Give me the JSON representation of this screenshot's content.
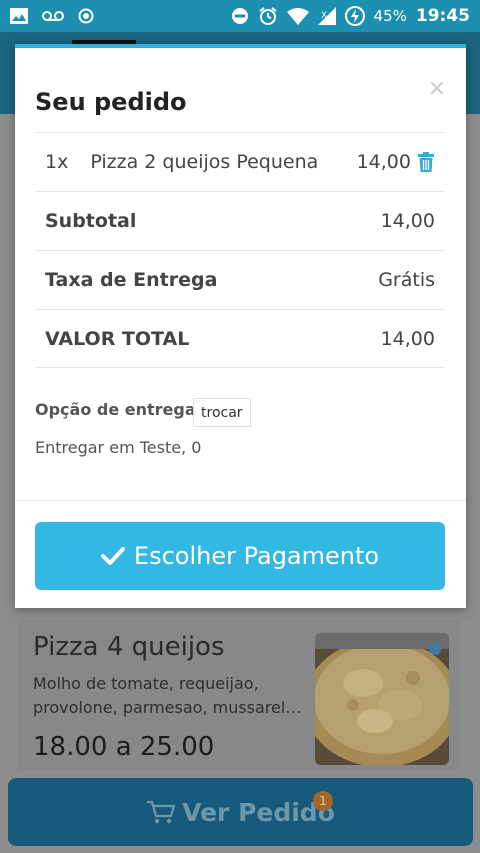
{
  "status_bar": {
    "battery_percent": "45%",
    "time": "19:45",
    "left_icons": [
      "image-icon",
      "voicemail-icon",
      "circle-dot-icon"
    ],
    "right_icons": [
      "dnd-icon",
      "alarm-icon",
      "wifi-icon",
      "signal-icon",
      "battery-icon"
    ]
  },
  "modal": {
    "title": "Seu pedido",
    "close_label": "×",
    "item": {
      "qty": "1x",
      "name": "Pizza 2 queijos Pequena",
      "price": "14,00"
    },
    "subtotal": {
      "label": "Subtotal",
      "value": "14,00"
    },
    "delivery_fee": {
      "label": "Taxa de Entrega",
      "value": "Grátis"
    },
    "total": {
      "label": "VALOR TOTAL",
      "value": "14,00"
    },
    "delivery_option_label": "Opção de entrega",
    "change_button": "trocar",
    "delivery_address": "Entregar em Teste, 0",
    "pay_button": "Escolher Pagamento"
  },
  "background": {
    "product": {
      "name": "Pizza 4 queijos",
      "description": "Molho de tomate, requeijao, provolone, parmesao, mussarel…",
      "price": "18.00 a 25.00"
    },
    "view_order_button": "Ver Pedido",
    "order_count": "1"
  },
  "colors": {
    "accent": "#32b8e3",
    "header": "#1d8fb0",
    "trash": "#3aa8d8"
  }
}
